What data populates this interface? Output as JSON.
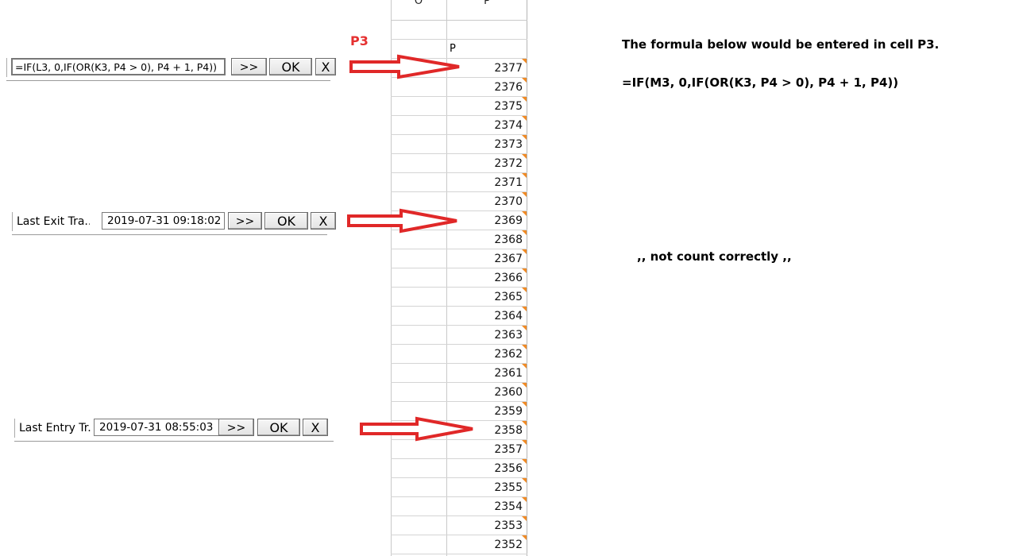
{
  "sheet": {
    "col_o": "O",
    "col_p": "P",
    "cell_p_label": "P",
    "values": [
      "2377",
      "2376",
      "2375",
      "2374",
      "2373",
      "2372",
      "2371",
      "2370",
      "2369",
      "2368",
      "2367",
      "2366",
      "2365",
      "2364",
      "2363",
      "2362",
      "2361",
      "2360",
      "2359",
      "2358",
      "2357",
      "2356",
      "2355",
      "2354",
      "2353",
      "2352"
    ]
  },
  "p3_label": "P3",
  "widget1": {
    "formula": "=IF(L3, 0,IF(OR(K3, P4 > 0), P4 + 1, P4))",
    "more": ">>",
    "ok": "OK",
    "close": "X"
  },
  "widget2": {
    "label": "Last Exit Tra...",
    "value": "2019-07-31  09:18:02",
    "more": ">>",
    "ok": "OK",
    "close": "X"
  },
  "widget3": {
    "label": "Last Entry Tr...",
    "value": "2019-07-31  08:55:03",
    "more": ">>",
    "ok": "OK",
    "close": "X"
  },
  "notes": {
    "heading": "The formula below would be entered in cell P3.",
    "formula": "=IF(M3, 0,IF(OR(K3, P4 > 0), P4 + 1, P4))",
    "comment": ",, not count  correctly ,,"
  },
  "colors": {
    "arrow": "#e02828",
    "triangle": "#f08a24"
  }
}
